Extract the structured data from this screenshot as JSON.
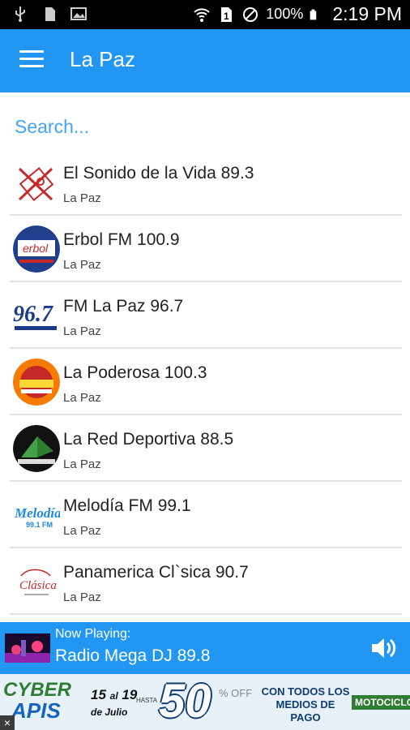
{
  "status_bar": {
    "icons_left": [
      "usb-icon",
      "sd-card-icon",
      "image-icon"
    ],
    "icons_right": [
      "wifi-icon",
      "sim-icon",
      "do-not-disturb-icon"
    ],
    "battery": "100%",
    "time": "2:19 PM"
  },
  "app_bar": {
    "title": "La Paz",
    "menu_icon": "hamburger-menu-icon"
  },
  "search": {
    "placeholder": "Search..."
  },
  "stations": [
    {
      "name": "El Sonido de la Vida 89.3",
      "city": "La Paz"
    },
    {
      "name": "Erbol FM 100.9",
      "city": "La Paz"
    },
    {
      "name": "FM La Paz 96.7",
      "city": "La Paz"
    },
    {
      "name": "La Poderosa 100.3",
      "city": "La Paz"
    },
    {
      "name": "La Red Deportiva 88.5",
      "city": "La Paz"
    },
    {
      "name": "Melodía FM 99.1",
      "city": "La Paz"
    },
    {
      "name": "Panamerica Cl`sica 90.7",
      "city": "La Paz"
    }
  ],
  "player": {
    "label": "Now Playing:",
    "title": "Radio Mega DJ 89.8",
    "volume_icon": "volume-icon"
  },
  "ad": {
    "brand_line1": "CYBER",
    "brand_line2": "APIS",
    "date_from": "15",
    "date_sep": "al",
    "date_to": "19",
    "month": "de Julio",
    "hasta": "HASTA",
    "discount": "50",
    "off": "% OFF",
    "medios": "CON TODOS LOS MEDIOS DE PAGO",
    "partner": "MOTOCICLO",
    "close": "×"
  },
  "colors": {
    "primary": "#2196f3",
    "search_text": "#42a5f5",
    "divider": "#e2e2e2"
  }
}
